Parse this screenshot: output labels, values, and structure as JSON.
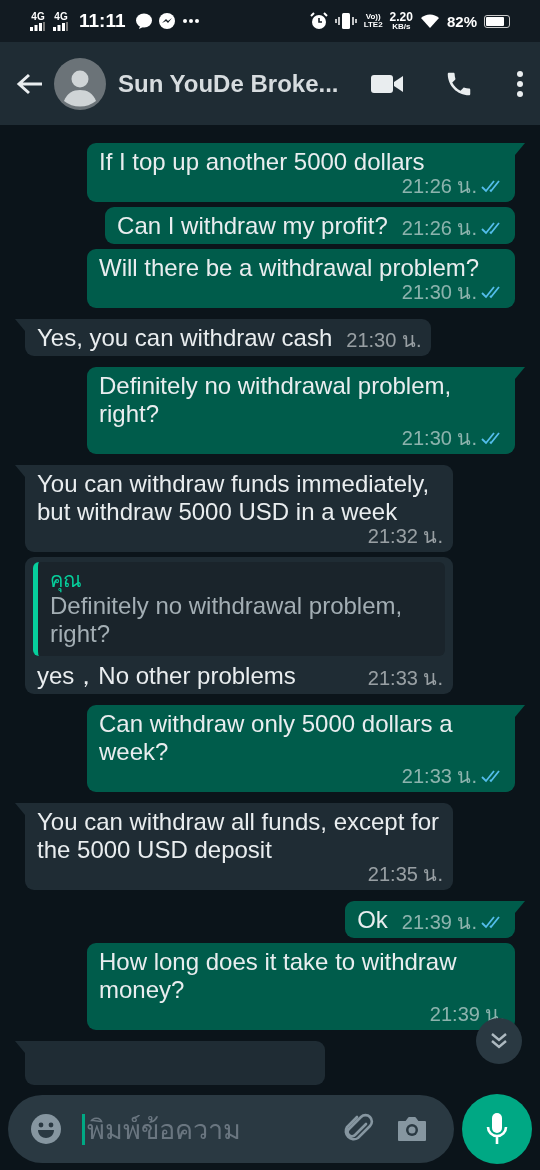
{
  "status_bar": {
    "networks": [
      "4G",
      "4G"
    ],
    "time": "11:11",
    "volte": "Vo))",
    "lte": "LTE2",
    "speed": "2.20",
    "speed_unit": "KB/s",
    "battery": "82%"
  },
  "header": {
    "contact_name": "Sun YouDe Broke..."
  },
  "messages": [
    {
      "kind": "sent",
      "text": "If I top up another 5000 dollars",
      "time": "21:26 น.",
      "read": true
    },
    {
      "kind": "sent",
      "text": "Can I withdraw my profit?",
      "time": "21:26 น.",
      "read": true
    },
    {
      "kind": "sent",
      "text": "Will there be a withdrawal problem?",
      "time": "21:30 น.",
      "read": true
    },
    {
      "kind": "received",
      "text": "Yes, you can withdraw cash",
      "time": "21:30 น."
    },
    {
      "kind": "sent",
      "text": "Definitely no withdrawal problem, right?",
      "time": "21:30 น.",
      "read": true
    },
    {
      "kind": "received",
      "text": "You can withdraw funds immediately, but withdraw 5000 USD in a week",
      "time": "21:32 น."
    },
    {
      "kind": "received",
      "quote": {
        "author": "คุณ",
        "text": "Definitely no withdrawal problem, right?"
      },
      "text": "yes，No other problems",
      "time": "21:33 น."
    },
    {
      "kind": "sent",
      "text": "Can withdraw only 5000 dollars a week?",
      "time": "21:33 น.",
      "read": true
    },
    {
      "kind": "received",
      "text": "You can withdraw all funds, except for the 5000 USD deposit",
      "time": "21:35 น."
    },
    {
      "kind": "sent",
      "text": "Ok",
      "time": "21:39 น.",
      "read": true
    },
    {
      "kind": "sent",
      "text": "How long does it take to withdraw money?",
      "time": "21:39 น."
    },
    {
      "kind": "received"
    }
  ],
  "composer": {
    "placeholder": "พิมพ์ข้อความ"
  }
}
